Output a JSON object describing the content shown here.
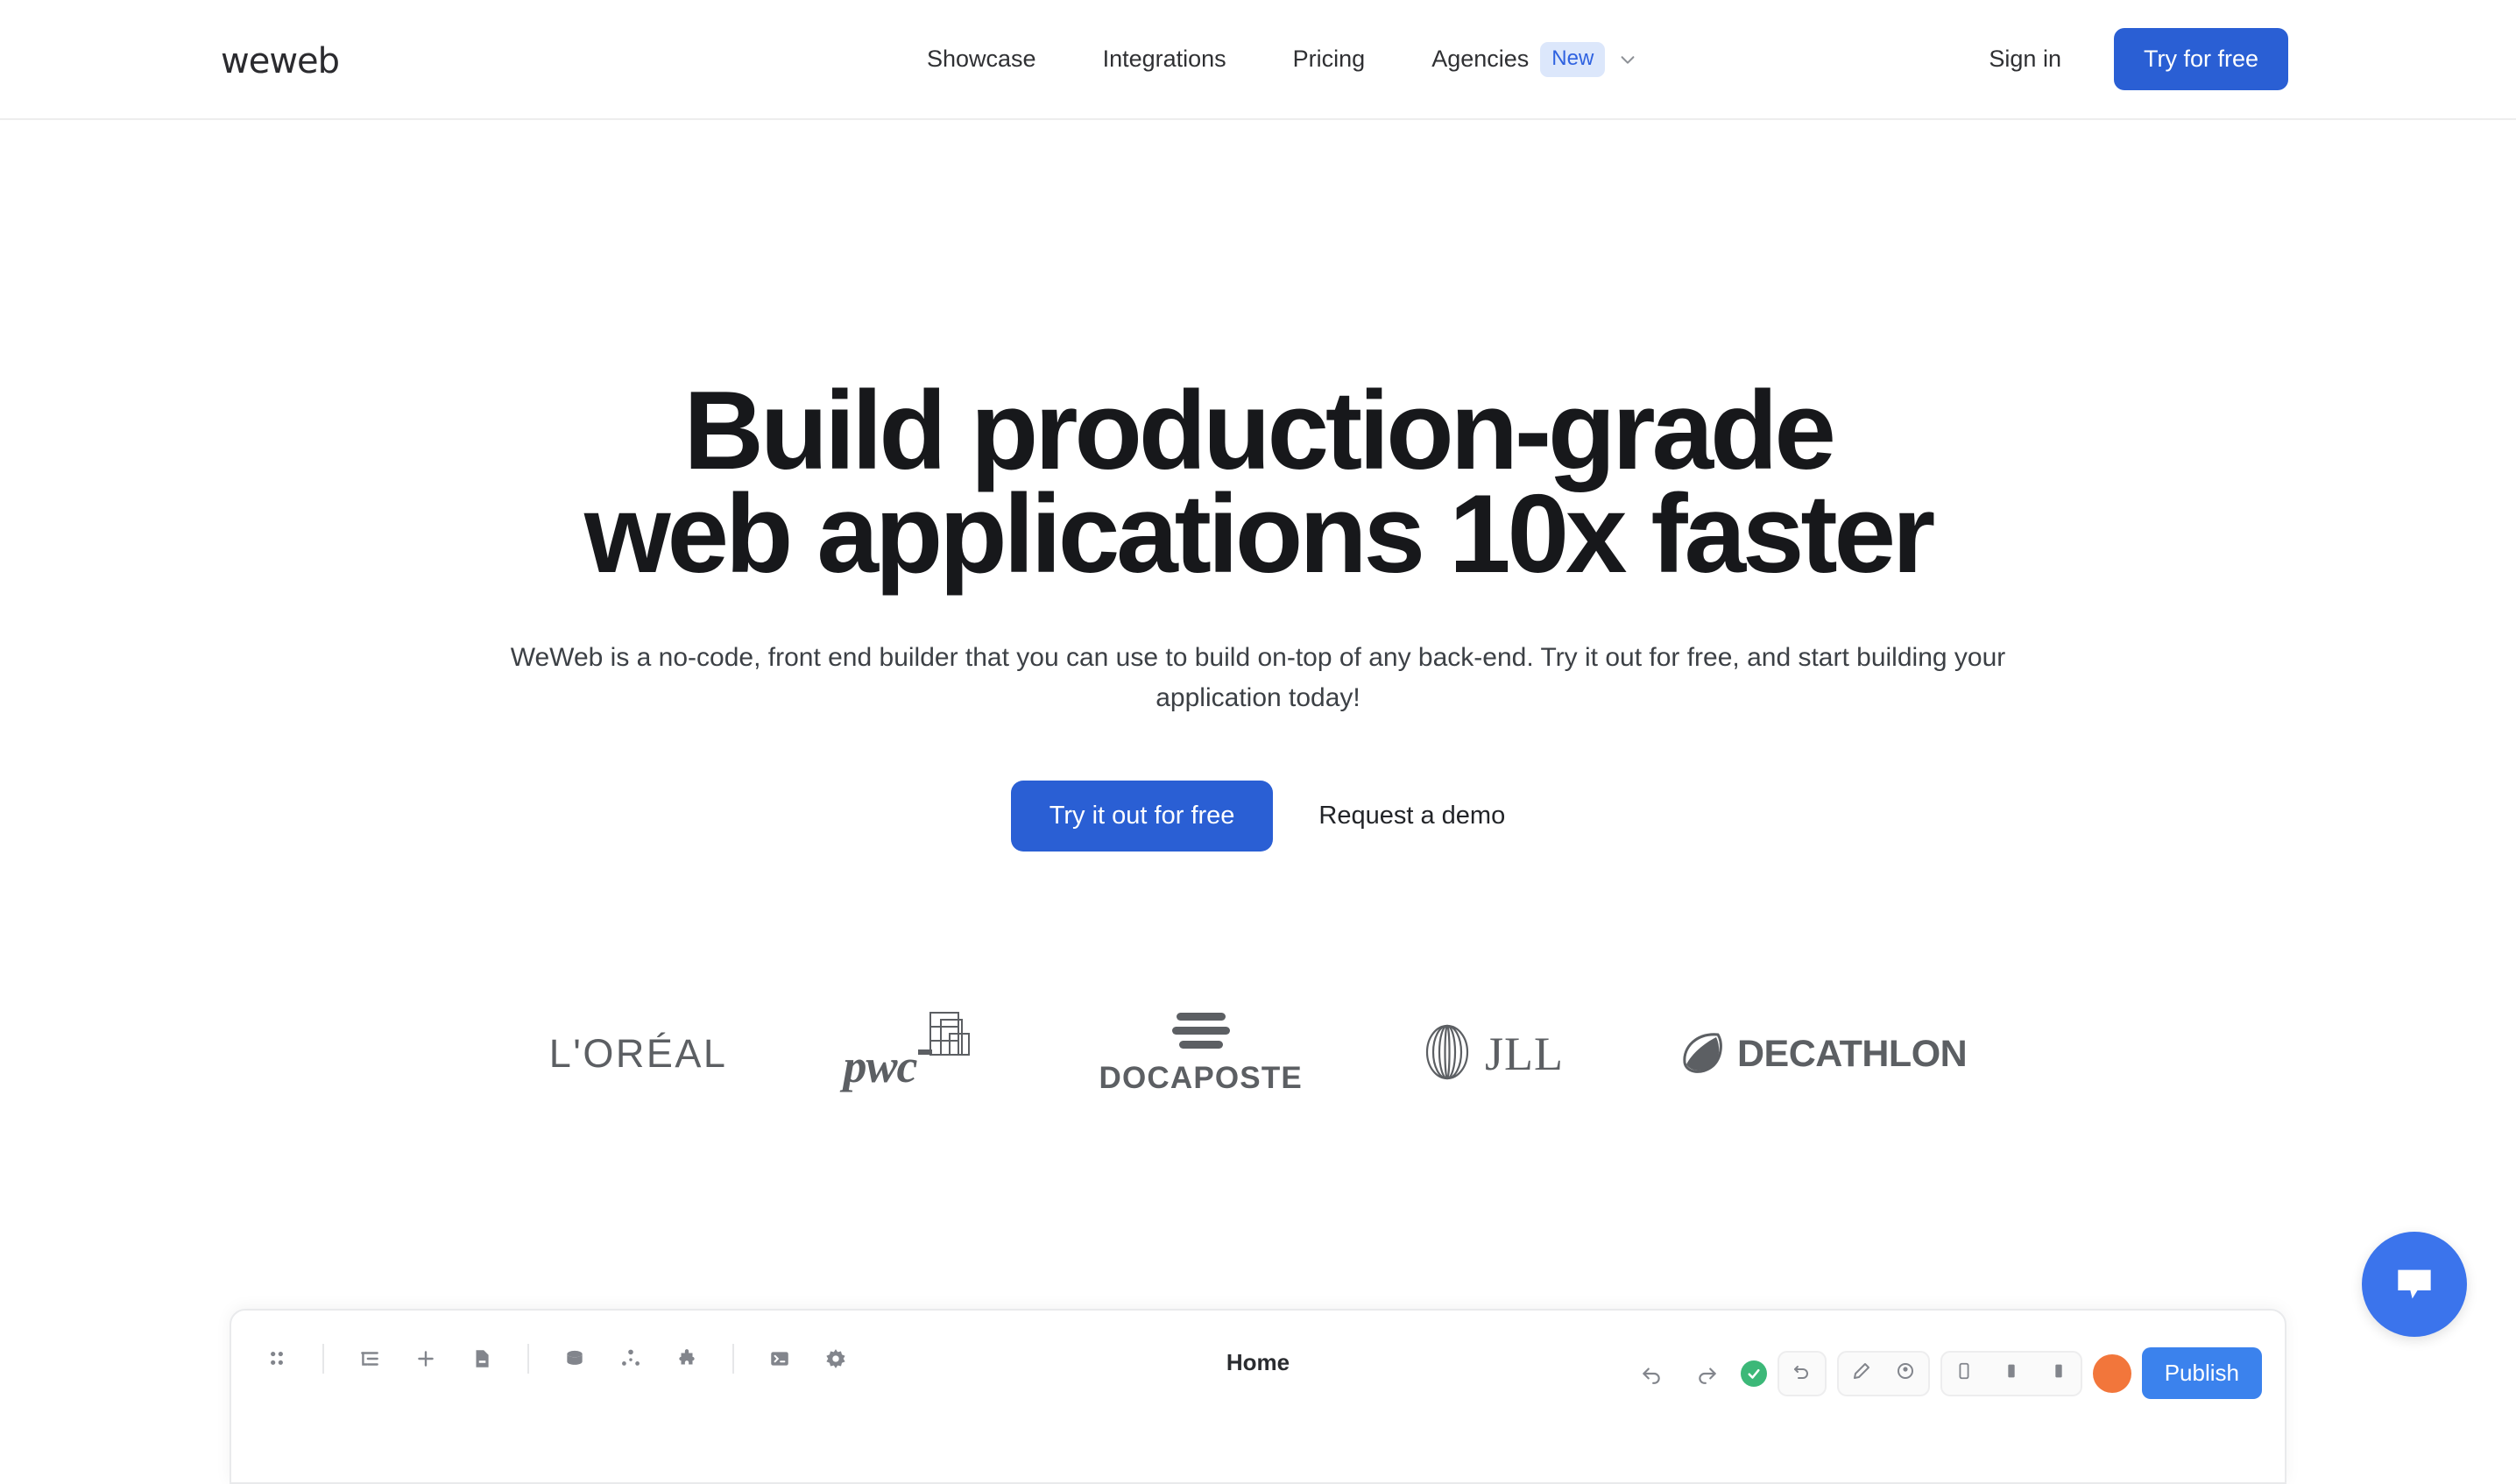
{
  "header": {
    "logo_text": "weweb",
    "nav": [
      {
        "label": "Showcase"
      },
      {
        "label": "Integrations"
      },
      {
        "label": "Pricing"
      }
    ],
    "agencies": {
      "label": "Agencies",
      "badge": "New",
      "chevron_icon": "chevron-down-icon"
    },
    "signin_label": "Sign in",
    "cta_label": "Try for free",
    "accent_color": "#2a5fd4",
    "badge_bg_color": "#dce7fb",
    "badge_text_color": "#2f62e0"
  },
  "hero": {
    "headline_line1": "Build production-grade",
    "headline_line2": "web applications 10x faster",
    "subtitle": "WeWeb is a no-code, front end builder that you can use to build on-top of any back-end. Try it out for free, and start building your application today!",
    "primary_cta": "Try it out for free",
    "secondary_cta": "Request a demo"
  },
  "logos": {
    "loreal": "L'ORÉAL",
    "pwc": "pwc",
    "docaposte": "DOCAPOSTE",
    "jll": "JLL",
    "decathlon": "DECATHLON",
    "logo_color": "#5c5f63"
  },
  "editor": {
    "page_title": "Home",
    "publish_label": "Publish",
    "publish_color": "#3b82ed",
    "avatar_color": "#f2763b",
    "saved_status_color": "#3cb878",
    "left_tools": [
      {
        "icon": "grid-dots-icon"
      },
      {
        "icon": "layers-tree-icon"
      },
      {
        "icon": "plus-icon"
      },
      {
        "icon": "page-file-icon"
      },
      {
        "icon": "database-icon"
      },
      {
        "icon": "workflow-icon"
      },
      {
        "icon": "plugin-puzzle-icon"
      },
      {
        "icon": "code-terminal-icon"
      },
      {
        "icon": "settings-gear-icon"
      }
    ],
    "right_tools": [
      {
        "icon": "undo-icon"
      },
      {
        "icon": "redo-icon"
      },
      {
        "icon": "saved-check-icon"
      },
      {
        "icon": "refresh-icon"
      },
      {
        "icon": "pen-edit-icon"
      },
      {
        "icon": "preview-eye-icon"
      },
      {
        "icon": "mobile-device-icon"
      },
      {
        "icon": "tablet-device-icon"
      },
      {
        "icon": "desktop-device-icon"
      }
    ]
  },
  "chat": {
    "icon": "chat-bubble-icon",
    "color": "#3b74ec"
  }
}
